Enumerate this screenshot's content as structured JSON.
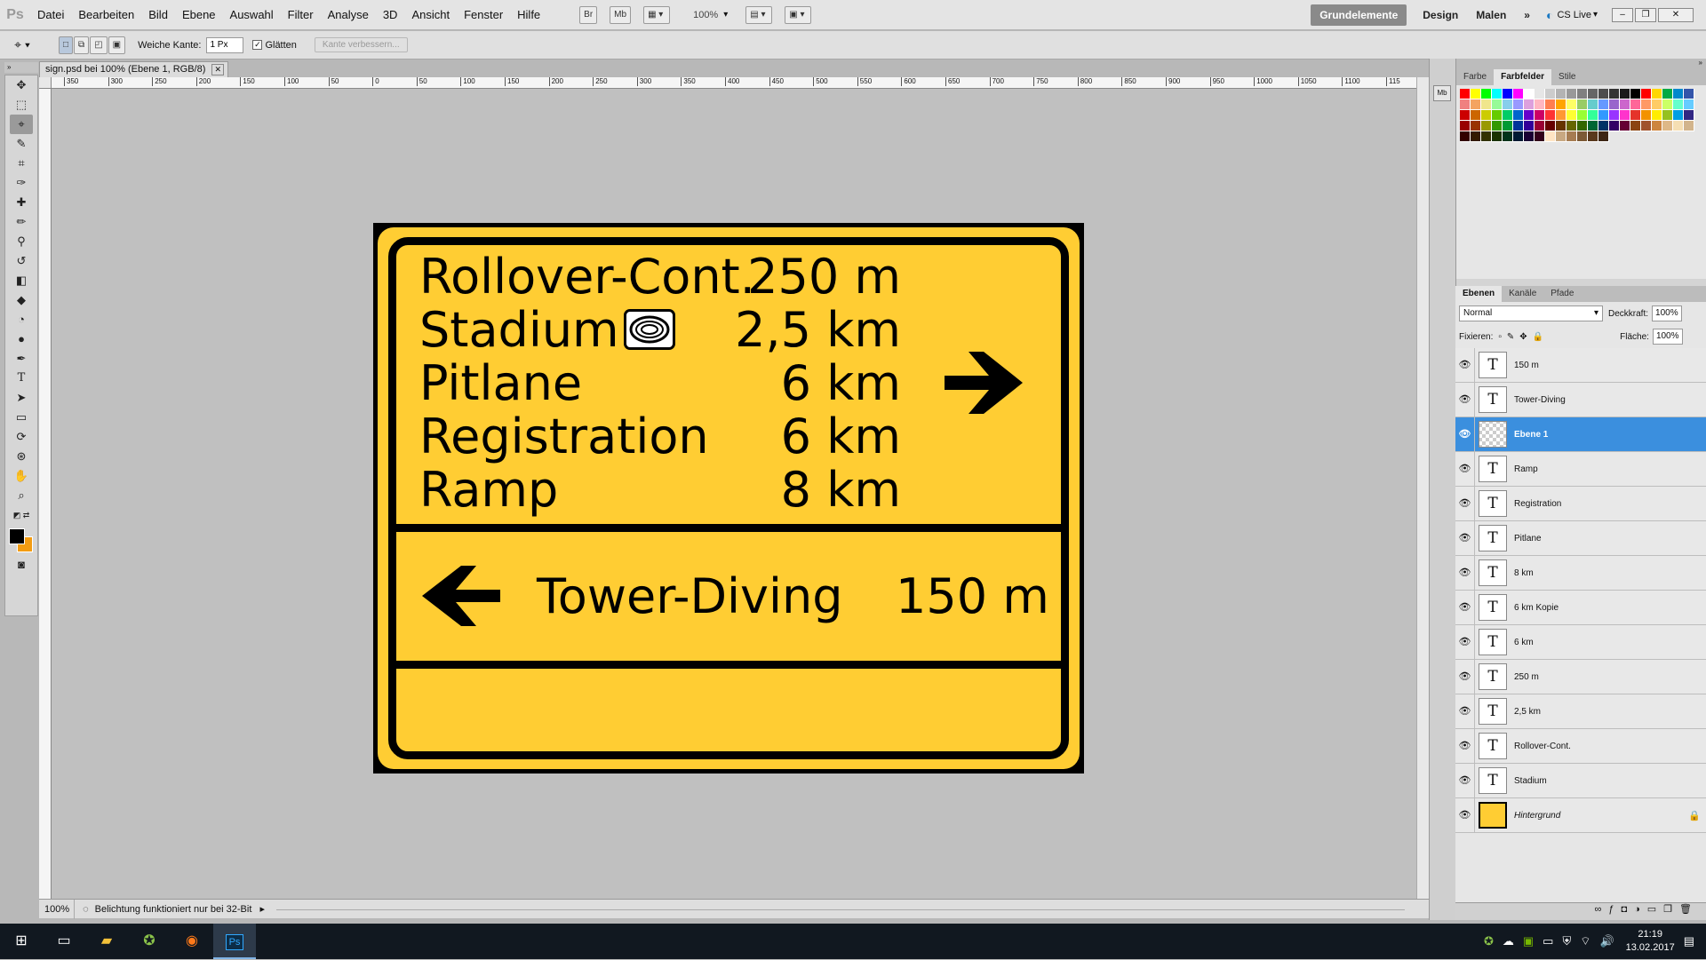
{
  "app": {
    "logo": "Ps"
  },
  "menu": [
    "Datei",
    "Bearbeiten",
    "Bild",
    "Ebene",
    "Auswahl",
    "Filter",
    "Analyse",
    "3D",
    "Ansicht",
    "Fenster",
    "Hilfe"
  ],
  "menubar_buttons": {
    "bridge": "Br",
    "mini_bridge": "Mb",
    "zoom": "100%"
  },
  "workspaces": {
    "active": "Grundelemente",
    "design": "Design",
    "paint": "Malen",
    "more": "»",
    "cslive": "CS Live"
  },
  "options": {
    "feather_label": "Weiche Kante:",
    "feather_value": "1 Px",
    "antialias_label": "Glätten",
    "antialias_checked": true,
    "refine_edge": "Kante verbessern..."
  },
  "document": {
    "tab_title": "sign.psd bei 100% (Ebene 1, RGB/8)",
    "zoom": "100%",
    "status": "Belichtung funktioniert nur bei 32-Bit"
  },
  "ruler_labels": [
    "350",
    "300",
    "250",
    "200",
    "150",
    "100",
    "50",
    "0",
    "50",
    "100",
    "150",
    "200",
    "250",
    "300",
    "350",
    "400",
    "450",
    "500",
    "550",
    "600",
    "650",
    "700",
    "750",
    "800",
    "850",
    "900",
    "950",
    "1000",
    "1050",
    "1100",
    "115"
  ],
  "sign": {
    "colors": {
      "background": "#ffcd33",
      "ink": "#000000"
    },
    "upper_rows": [
      {
        "destination": "Rollover-Cont.",
        "distance": "250 m"
      },
      {
        "destination": "Stadium",
        "distance": "2,5 km"
      },
      {
        "destination": "Pitlane",
        "distance": "6 km"
      },
      {
        "destination": "Registration",
        "distance": "6 km"
      },
      {
        "destination": "Ramp",
        "distance": "8 km"
      }
    ],
    "upper_arrow": "→",
    "lower_row": {
      "destination": "Tower-Diving",
      "distance": "150 m",
      "arrow": "←"
    },
    "stadium_icon": "stadium-icon"
  },
  "panels": {
    "top_tabs": [
      "Farbe",
      "Farbfelder",
      "Stile"
    ],
    "top_active": "Farbfelder",
    "layer_tabs": [
      "Ebenen",
      "Kanäle",
      "Pfade"
    ],
    "layer_active": "Ebenen",
    "blend_mode": "Normal",
    "opacity_label": "Deckkraft:",
    "opacity_value": "100%",
    "lock_label": "Fixieren:",
    "fill_label": "Fläche:",
    "fill_value": "100%"
  },
  "layers": [
    {
      "name": "150 m",
      "type": "text"
    },
    {
      "name": "Tower-Diving",
      "type": "text"
    },
    {
      "name": "Ebene 1",
      "type": "pixel",
      "selected": true
    },
    {
      "name": "Ramp",
      "type": "text"
    },
    {
      "name": "Registration",
      "type": "text"
    },
    {
      "name": "Pitlane",
      "type": "text"
    },
    {
      "name": "8 km",
      "type": "text"
    },
    {
      "name": "6 km Kopie",
      "type": "text"
    },
    {
      "name": "6 km",
      "type": "text"
    },
    {
      "name": "250 m",
      "type": "text"
    },
    {
      "name": "2,5 km",
      "type": "text"
    },
    {
      "name": "Rollover-Cont.",
      "type": "text"
    },
    {
      "name": "Stadium",
      "type": "text"
    },
    {
      "name": "Hintergrund",
      "type": "background",
      "locked": true
    }
  ],
  "swatch_colors": [
    [
      "#ff0000",
      "#ffff00",
      "#00ff00",
      "#00ffff",
      "#0000ff",
      "#ff00ff",
      "#ffffff",
      "#e6e6e6",
      "#cccccc",
      "#b3b3b3",
      "#999999",
      "#808080",
      "#666666",
      "#4d4d4d",
      "#333333",
      "#1a1a1a",
      "#000000",
      "#ff0000",
      "#ffd700",
      "#00aa44",
      "#0088cc",
      "#3355aa"
    ],
    [
      "#f08080",
      "#f4a460",
      "#f0e68c",
      "#98fb98",
      "#87ceeb",
      "#9999ff",
      "#dda0dd",
      "#ffb6c1",
      "#ff7f50",
      "#ffa500",
      "#ffff66",
      "#99cc66",
      "#66cccc",
      "#6699ff",
      "#9966cc",
      "#cc66cc",
      "#ff6699",
      "#ff9966",
      "#ffcc66",
      "#ccff66",
      "#66ffcc",
      "#66ccff"
    ],
    [
      "#cc0000",
      "#cc6600",
      "#cccc00",
      "#66cc00",
      "#00cc66",
      "#0066cc",
      "#6600cc",
      "#cc0066",
      "#ff3333",
      "#ff9933",
      "#ffff33",
      "#99ff33",
      "#33ff99",
      "#3399ff",
      "#9933ff",
      "#ff33cc",
      "#e5332a",
      "#f39200",
      "#ffed00",
      "#95c11f",
      "#009fe3",
      "#312783"
    ],
    [
      "#990000",
      "#993300",
      "#999900",
      "#339900",
      "#009933",
      "#003399",
      "#330099",
      "#990033",
      "#660000",
      "#663300",
      "#666600",
      "#336600",
      "#006633",
      "#003366",
      "#330066",
      "#660033",
      "#8b4513",
      "#a0522d",
      "#cd853f",
      "#deb887",
      "#f5deb3",
      "#d2b48c"
    ],
    [
      "#330000",
      "#331a00",
      "#333300",
      "#1a3300",
      "#00331a",
      "#001a33",
      "#1a0033",
      "#33001a",
      "#ffe4c4",
      "#c8a882",
      "#a67c52",
      "#7c5a36",
      "#59391d",
      "#3d2614"
    ]
  ],
  "taskbar": {
    "items": [
      "windows-start",
      "task-view",
      "file-explorer",
      "maps-app",
      "firefox",
      "photoshop"
    ],
    "time": "21:19",
    "date": "13.02.2017"
  }
}
